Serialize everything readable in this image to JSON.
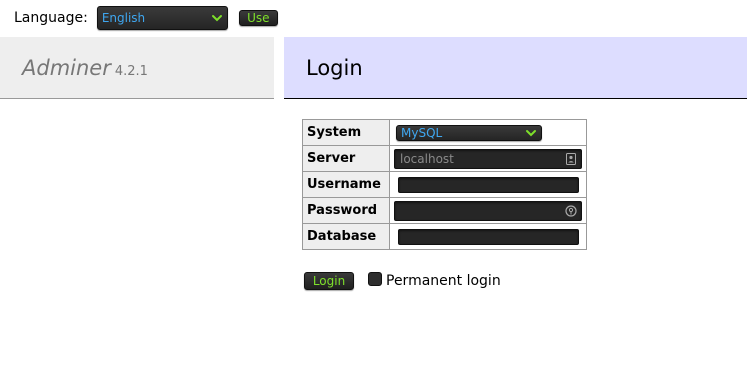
{
  "lang": {
    "label": "Language:",
    "selected": "English",
    "use_label": "Use"
  },
  "menu": {
    "app_name": "Adminer",
    "version": "4.2.1"
  },
  "content": {
    "title": "Login"
  },
  "form": {
    "system_label": "System",
    "system_value": "MySQL",
    "server_label": "Server",
    "server_value": "localhost",
    "username_label": "Username",
    "username_value": "",
    "password_label": "Password",
    "password_value": "",
    "database_label": "Database",
    "database_value": "",
    "login_label": "Login",
    "permanent_label": "Permanent login",
    "permanent_checked": false
  },
  "icons": {
    "select_chevron": "chevron-down-icon",
    "server_field": "contact-card-icon",
    "password_field": "key-icon"
  },
  "colors": {
    "accent_green": "#7ee02a",
    "accent_blue": "#3fa7f0",
    "header_purple": "#ddddff",
    "header_gray": "#eeeeee"
  }
}
